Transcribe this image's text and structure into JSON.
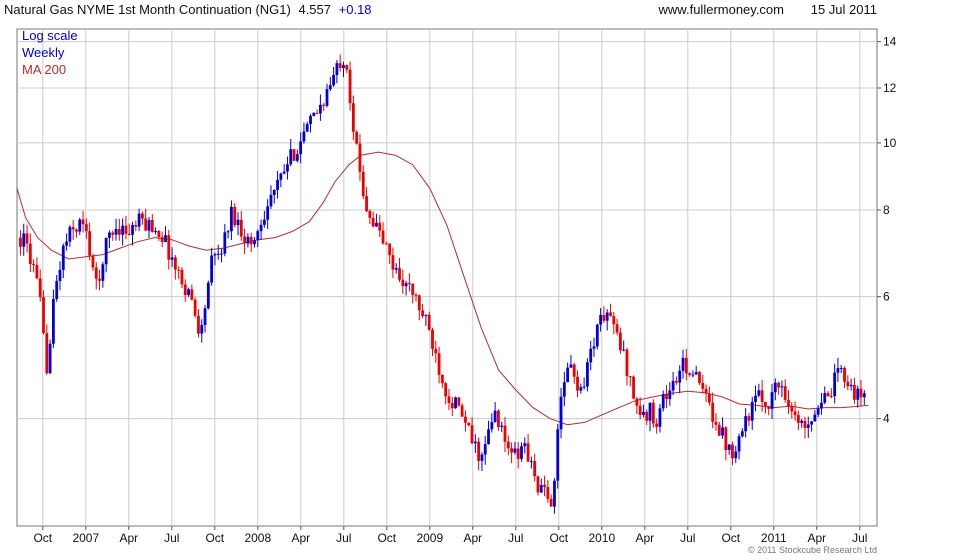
{
  "chart_data": {
    "type": "candlestick",
    "title": "Natural Gas NYME 1st Month Continuation (NG1)",
    "last_price": "4.557",
    "change": "+0.18",
    "source": "www.fullermoney.com",
    "date": "15 Jul 2011",
    "copyright": "© 2011 Stockcube Research Ltd",
    "legend": [
      {
        "label": "Log scale",
        "color": "#0000cc"
      },
      {
        "label": "Weekly",
        "color": "#0000cc"
      },
      {
        "label": "MA 200",
        "color": "#b03030"
      }
    ],
    "y_scale": "log",
    "ylim": [
      2.8,
      14.6
    ],
    "y_ticks": [
      4,
      6,
      8,
      10,
      12,
      14
    ],
    "x_range": [
      2006.6,
      2011.6
    ],
    "x_ticks": [
      {
        "label": "Oct",
        "t": 2006.75
      },
      {
        "label": "2007",
        "t": 2007.0
      },
      {
        "label": "Apr",
        "t": 2007.25
      },
      {
        "label": "Jul",
        "t": 2007.5
      },
      {
        "label": "Oct",
        "t": 2007.75
      },
      {
        "label": "2008",
        "t": 2008.0
      },
      {
        "label": "Apr",
        "t": 2008.25
      },
      {
        "label": "Jul",
        "t": 2008.5
      },
      {
        "label": "Oct",
        "t": 2008.75
      },
      {
        "label": "2009",
        "t": 2009.0
      },
      {
        "label": "Apr",
        "t": 2009.25
      },
      {
        "label": "Jul",
        "t": 2009.5
      },
      {
        "label": "Oct",
        "t": 2009.75
      },
      {
        "label": "2010",
        "t": 2010.0
      },
      {
        "label": "Apr",
        "t": 2010.25
      },
      {
        "label": "Jul",
        "t": 2010.5
      },
      {
        "label": "Oct",
        "t": 2010.75
      },
      {
        "label": "2011",
        "t": 2011.0
      },
      {
        "label": "Apr",
        "t": 2011.25
      },
      {
        "label": "Jul",
        "t": 2011.5
      }
    ],
    "grid": true,
    "colors": {
      "up": "#0000dd",
      "down": "#ee0000",
      "ma": "#b03030",
      "grid": "#cccccc"
    },
    "price_path": [
      [
        2006.62,
        7.3
      ],
      [
        2006.66,
        7.1
      ],
      [
        2006.7,
        6.5
      ],
      [
        2006.73,
        6.0
      ],
      [
        2006.76,
        5.0
      ],
      [
        2006.78,
        4.7
      ],
      [
        2006.81,
        5.8
      ],
      [
        2006.84,
        6.5
      ],
      [
        2006.88,
        7.2
      ],
      [
        2006.93,
        7.5
      ],
      [
        2006.97,
        7.7
      ],
      [
        2007.0,
        7.4
      ],
      [
        2007.03,
        6.9
      ],
      [
        2007.07,
        6.0
      ],
      [
        2007.1,
        6.9
      ],
      [
        2007.14,
        7.4
      ],
      [
        2007.19,
        7.6
      ],
      [
        2007.25,
        7.4
      ],
      [
        2007.31,
        7.7
      ],
      [
        2007.38,
        7.6
      ],
      [
        2007.44,
        7.4
      ],
      [
        2007.48,
        7.0
      ],
      [
        2007.52,
        6.6
      ],
      [
        2007.56,
        6.3
      ],
      [
        2007.6,
        6.1
      ],
      [
        2007.64,
        5.6
      ],
      [
        2007.67,
        5.3
      ],
      [
        2007.7,
        6.0
      ],
      [
        2007.73,
        6.7
      ],
      [
        2007.77,
        6.9
      ],
      [
        2007.81,
        7.3
      ],
      [
        2007.85,
        8.0
      ],
      [
        2007.89,
        7.6
      ],
      [
        2007.93,
        7.3
      ],
      [
        2007.97,
        7.1
      ],
      [
        2008.0,
        7.5
      ],
      [
        2008.04,
        8.0
      ],
      [
        2008.08,
        8.4
      ],
      [
        2008.12,
        8.7
      ],
      [
        2008.16,
        9.2
      ],
      [
        2008.2,
        9.6
      ],
      [
        2008.24,
        10.0
      ],
      [
        2008.28,
        10.4
      ],
      [
        2008.32,
        10.8
      ],
      [
        2008.36,
        11.3
      ],
      [
        2008.4,
        11.8
      ],
      [
        2008.44,
        12.4
      ],
      [
        2008.48,
        13.2
      ],
      [
        2008.51,
        13.4
      ],
      [
        2008.53,
        12.2
      ],
      [
        2008.55,
        10.8
      ],
      [
        2008.58,
        9.5
      ],
      [
        2008.61,
        8.6
      ],
      [
        2008.64,
        8.0
      ],
      [
        2008.67,
        7.7
      ],
      [
        2008.71,
        7.4
      ],
      [
        2008.75,
        7.0
      ],
      [
        2008.79,
        6.6
      ],
      [
        2008.83,
        6.4
      ],
      [
        2008.87,
        6.2
      ],
      [
        2008.91,
        6.0
      ],
      [
        2008.95,
        5.7
      ],
      [
        2008.99,
        5.4
      ],
      [
        2009.03,
        5.0
      ],
      [
        2009.07,
        4.6
      ],
      [
        2009.11,
        4.3
      ],
      [
        2009.15,
        4.2
      ],
      [
        2009.19,
        4.0
      ],
      [
        2009.23,
        3.8
      ],
      [
        2009.27,
        3.6
      ],
      [
        2009.31,
        3.5
      ],
      [
        2009.35,
        3.9
      ],
      [
        2009.39,
        4.1
      ],
      [
        2009.43,
        3.7
      ],
      [
        2009.47,
        3.6
      ],
      [
        2009.51,
        3.5
      ],
      [
        2009.55,
        3.7
      ],
      [
        2009.59,
        3.4
      ],
      [
        2009.63,
        3.2
      ],
      [
        2009.67,
        3.1
      ],
      [
        2009.7,
        3.0
      ],
      [
        2009.73,
        3.4
      ],
      [
        2009.76,
        4.2
      ],
      [
        2009.8,
        4.8
      ],
      [
        2009.84,
        4.6
      ],
      [
        2009.88,
        4.4
      ],
      [
        2009.92,
        4.8
      ],
      [
        2009.96,
        5.3
      ],
      [
        2010.0,
        5.6
      ],
      [
        2010.04,
        5.7
      ],
      [
        2010.08,
        5.3
      ],
      [
        2010.12,
        5.0
      ],
      [
        2010.16,
        4.6
      ],
      [
        2010.2,
        4.2
      ],
      [
        2010.24,
        4.0
      ],
      [
        2010.28,
        4.1
      ],
      [
        2010.32,
        4.0
      ],
      [
        2010.36,
        4.3
      ],
      [
        2010.4,
        4.4
      ],
      [
        2010.44,
        4.6
      ],
      [
        2010.48,
        4.8
      ],
      [
        2010.52,
        4.7
      ],
      [
        2010.56,
        4.5
      ],
      [
        2010.6,
        4.3
      ],
      [
        2010.64,
        4.1
      ],
      [
        2010.68,
        3.9
      ],
      [
        2010.72,
        3.7
      ],
      [
        2010.76,
        3.6
      ],
      [
        2010.8,
        3.8
      ],
      [
        2010.84,
        4.0
      ],
      [
        2010.88,
        4.2
      ],
      [
        2010.92,
        4.3
      ],
      [
        2010.96,
        4.2
      ],
      [
        2011.0,
        4.4
      ],
      [
        2011.04,
        4.5
      ],
      [
        2011.08,
        4.3
      ],
      [
        2011.12,
        4.0
      ],
      [
        2011.16,
        3.9
      ],
      [
        2011.2,
        4.0
      ],
      [
        2011.24,
        4.1
      ],
      [
        2011.28,
        4.3
      ],
      [
        2011.32,
        4.2
      ],
      [
        2011.36,
        4.6
      ],
      [
        2011.4,
        4.7
      ],
      [
        2011.44,
        4.5
      ],
      [
        2011.48,
        4.3
      ],
      [
        2011.52,
        4.3
      ],
      [
        2011.54,
        4.557
      ]
    ],
    "ma_200": [
      [
        2006.6,
        8.6
      ],
      [
        2006.65,
        7.8
      ],
      [
        2006.72,
        7.3
      ],
      [
        2006.8,
        7.0
      ],
      [
        2006.9,
        6.8
      ],
      [
        2007.0,
        6.85
      ],
      [
        2007.1,
        6.9
      ],
      [
        2007.2,
        7.05
      ],
      [
        2007.3,
        7.2
      ],
      [
        2007.4,
        7.3
      ],
      [
        2007.5,
        7.25
      ],
      [
        2007.6,
        7.1
      ],
      [
        2007.7,
        7.0
      ],
      [
        2007.8,
        7.05
      ],
      [
        2007.9,
        7.15
      ],
      [
        2008.0,
        7.25
      ],
      [
        2008.1,
        7.3
      ],
      [
        2008.2,
        7.45
      ],
      [
        2008.3,
        7.7
      ],
      [
        2008.38,
        8.2
      ],
      [
        2008.45,
        8.8
      ],
      [
        2008.53,
        9.3
      ],
      [
        2008.6,
        9.6
      ],
      [
        2008.7,
        9.7
      ],
      [
        2008.8,
        9.6
      ],
      [
        2008.9,
        9.3
      ],
      [
        2009.0,
        8.6
      ],
      [
        2009.1,
        7.6
      ],
      [
        2009.2,
        6.4
      ],
      [
        2009.3,
        5.4
      ],
      [
        2009.4,
        4.7
      ],
      [
        2009.5,
        4.4
      ],
      [
        2009.6,
        4.15
      ],
      [
        2009.7,
        4.0
      ],
      [
        2009.8,
        3.92
      ],
      [
        2009.9,
        3.95
      ],
      [
        2010.0,
        4.05
      ],
      [
        2010.1,
        4.15
      ],
      [
        2010.2,
        4.25
      ],
      [
        2010.3,
        4.3
      ],
      [
        2010.4,
        4.35
      ],
      [
        2010.5,
        4.38
      ],
      [
        2010.6,
        4.36
      ],
      [
        2010.7,
        4.3
      ],
      [
        2010.8,
        4.2
      ],
      [
        2010.9,
        4.18
      ],
      [
        2011.0,
        4.15
      ],
      [
        2011.1,
        4.17
      ],
      [
        2011.2,
        4.13
      ],
      [
        2011.3,
        4.15
      ],
      [
        2011.4,
        4.15
      ],
      [
        2011.5,
        4.17
      ],
      [
        2011.55,
        4.18
      ]
    ]
  }
}
